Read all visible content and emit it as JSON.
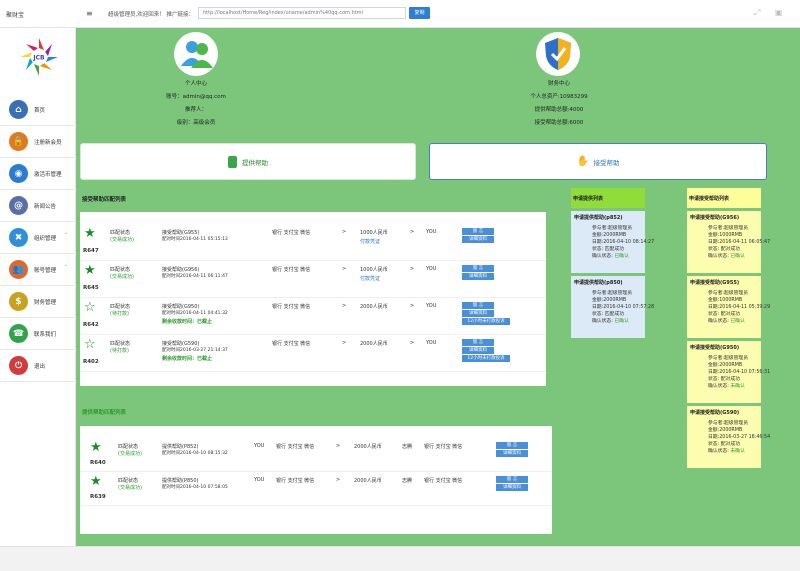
{
  "topbar": {
    "brand": "聚财宝",
    "menu_icon": "hamburger-icon",
    "welcome": "超级管理员,欢迎回来！ 推广链接：",
    "link_value": "http://localhost/Home/Reg/index/uname/admin%40qq.com.html",
    "copy_label": "复制",
    "right_icons": [
      "expand-icon",
      "window-icon"
    ]
  },
  "sidebar": {
    "logo_text": "JCB",
    "items": [
      {
        "label": "首页",
        "icon": "house-icon",
        "color": "#3b6fb5",
        "glyph": "⌂"
      },
      {
        "label": "注册新会员",
        "icon": "lock-icon",
        "color": "#e07a1f",
        "glyph": "🔒"
      },
      {
        "label": "激活币管理",
        "icon": "globe-icon",
        "color": "#2b7cd0",
        "glyph": "◉"
      },
      {
        "label": "新闻公告",
        "icon": "at-icon",
        "color": "#5a6fa8",
        "glyph": "@"
      },
      {
        "label": "组织管理",
        "icon": "network-icon",
        "color": "#2f8fd8",
        "glyph": "✖",
        "arrow": true
      },
      {
        "label": "账号管理",
        "icon": "users-icon",
        "color": "#d86a32",
        "glyph": "👥",
        "arrow": true
      },
      {
        "label": "财务管理",
        "icon": "dollar-icon",
        "color": "#c8a21c",
        "glyph": "$"
      },
      {
        "label": "联系我们",
        "icon": "contact-icon",
        "color": "#2fa54b",
        "glyph": "☎"
      },
      {
        "label": "退出",
        "icon": "power-icon",
        "color": "#d23b3b",
        "glyph": "⏻"
      }
    ]
  },
  "personal": {
    "title": "个人中心",
    "account": "账号：admin@qq.com",
    "referrer": "推荐人：",
    "level": "级别：高级会员"
  },
  "finance": {
    "title": "财务中心",
    "total_assets": "个人总资产:10983299",
    "provide_total": "提供帮助总额:4000",
    "receive_total": "接受帮助总额:6000"
  },
  "actions": {
    "provide_label": "提供帮助",
    "receive_label": "接受帮助"
  },
  "receive_match": {
    "title": "接受帮助匹配列表",
    "rows": [
      {
        "id": "R647",
        "starred": true,
        "status_label": "匹配状态",
        "status": "(交易成功)",
        "name": "接受帮助(G955)",
        "time": "配对时间2016-04-11 05:15:13",
        "payment": "银行 支付宝 微信",
        "arrow1": ">",
        "amount": "1000人民币",
        "sub": "付款凭证",
        "arrow2": ">",
        "you": "YOU",
        "btn1": "留 言",
        "btn2": "详细资料"
      },
      {
        "id": "R645",
        "starred": true,
        "status_label": "匹配状态",
        "status": "(交易成功)",
        "name": "接受帮助(G956)",
        "time": "配对时间2016-04-11 06:11:47",
        "payment": "银行 支付宝 微信",
        "arrow1": ">",
        "amount": "1000人民币",
        "sub": "付款凭证",
        "arrow2": ">",
        "you": "YOU",
        "btn1": "留 言",
        "btn2": "详细资料"
      },
      {
        "id": "R642",
        "starred": false,
        "status_label": "匹配状态",
        "status": "(待打款)",
        "name": "接受帮助(G950)",
        "time": "配对时间2016-04-11 04:41:32",
        "left": "剩余收款时间：已截止",
        "payment": "银行 支付宝 微信",
        "arrow1": ">",
        "amount": "2000人民币",
        "arrow2": ">",
        "you": "YOU",
        "btn1": "留 言",
        "btn2": "详细资料",
        "btn3": "12小时未打款投诉"
      },
      {
        "id": "R402",
        "starred": false,
        "status_label": "匹配状态",
        "status": "(待打款)",
        "name": "接受帮助(G590)",
        "time": "配对时间2016-03-27 21:14:37",
        "left": "剩余收款时间：已截止",
        "payment": "银行 支付宝 微信",
        "arrow1": ">",
        "amount": "2000人民币",
        "arrow2": ">",
        "you": "YOU",
        "btn1": "留 言",
        "btn2": "详细资料",
        "btn3": "12小时未打款投诉"
      }
    ]
  },
  "provide_match": {
    "title": "提供帮助匹配列表",
    "rows": [
      {
        "id": "R640",
        "starred": true,
        "status_label": "匹配状态",
        "status": "(交易成功)",
        "name": "提供帮助(P852)",
        "time": "配对时间2016-04-10 08:15:32",
        "you": "YOU",
        "payment": "银行 支付宝 微信",
        "arrow": ">",
        "amount": "2000人民币",
        "who": "志腾",
        "payment2": "银行 支付宝 微信",
        "btn1": "留 言",
        "btn2": "详细资料"
      },
      {
        "id": "R639",
        "starred": true,
        "status_label": "匹配状态",
        "status": "(交易成功)",
        "name": "提供帮助(P850)",
        "time": "配对时间2016-04-10 07:58:05",
        "you": "YOU",
        "payment": "银行 支付宝 微信",
        "arrow": ">",
        "amount": "2000人民币",
        "who": "志腾",
        "payment2": "银行 支付宝 微信",
        "btn1": "留 言",
        "btn2": "详细资料"
      }
    ]
  },
  "provide_apply": {
    "title": "申请提供列表",
    "cards": [
      {
        "title": "申请提供帮助(p852)",
        "participant": "参与者:超级管理员",
        "amount": "金额:2000RMB",
        "date": "日期:2016-04-10 08:14:27",
        "state": "状态: 匹配成功",
        "confirm_label": "确认状态: ",
        "confirm": "已确认"
      },
      {
        "title": "申请提供帮助(p850)",
        "participant": "参与者:超级管理员",
        "amount": "金额:2000RMB",
        "date": "日期:2016-04-10 07:57:28",
        "state": "状态: 匹配成功",
        "confirm_label": "确认状态: ",
        "confirm": "已确认"
      }
    ]
  },
  "receive_apply": {
    "title": "申请接受帮助列表",
    "cards": [
      {
        "title": "申请接受帮助(G956)",
        "participant": "参与者:超级管理员",
        "amount": "金额:1000RMB",
        "date": "日期:2016-04-11 06:05:47",
        "state": "状态: 配对成功",
        "confirm_label": "确认状态: ",
        "confirm": "已确认"
      },
      {
        "title": "申请接受帮助(G955)",
        "participant": "参与者:超级管理员",
        "amount": "金额:1000RMB",
        "date": "日期:2016-04-11 05:39:29",
        "state": "状态: 配对成功",
        "confirm_label": "确认状态: ",
        "confirm": "已确认"
      },
      {
        "title": "申请接受帮助(G950)",
        "participant": "参与者:超级管理员",
        "amount": "金额:2000RMB",
        "date": "日期:2016-04-10 07:56:31",
        "state": "状态: 配对成功",
        "confirm_label": "确认状态: ",
        "confirm": "未确认"
      },
      {
        "title": "申请接受帮助(G590)",
        "participant": "参与者:超级管理员",
        "amount": "金额:2000RMB",
        "date": "日期:2016-03-27 18:46:54",
        "state": "状态: 配对成功",
        "confirm_label": "确认状态: ",
        "confirm": "未确认"
      }
    ]
  }
}
